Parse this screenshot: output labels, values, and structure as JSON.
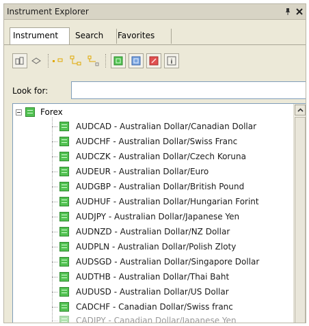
{
  "window": {
    "title": "Instrument Explorer"
  },
  "tabs": [
    {
      "label": "Instrument"
    },
    {
      "label": "Search"
    },
    {
      "label": "Favorites"
    }
  ],
  "toolbar": {
    "icons": [
      "grid-view-icon",
      "list-view-icon",
      "expand-tree-icon",
      "collapse-tree-icon",
      "group-tree-icon",
      "add-instrument-icon",
      "edit-instrument-icon",
      "delete-instrument-icon",
      "info-icon"
    ]
  },
  "lookfor": {
    "label": "Look for:",
    "value": ""
  },
  "tree": {
    "root": {
      "label": "Forex"
    },
    "items": [
      {
        "label": "AUDCAD - Australian Dollar/Canadian Dollar"
      },
      {
        "label": "AUDCHF - Australian Dollar/Swiss Franc"
      },
      {
        "label": "AUDCZK - Australian Dollar/Czech Koruna"
      },
      {
        "label": "AUDEUR - Australian Dollar/Euro"
      },
      {
        "label": "AUDGBP - Australian Dollar/British Pound"
      },
      {
        "label": "AUDHUF - Australian Dollar/Hungarian Forint"
      },
      {
        "label": "AUDJPY - Australian Dollar/Japanese Yen"
      },
      {
        "label": "AUDNZD - Australian Dollar/NZ Dollar"
      },
      {
        "label": "AUDPLN - Australian Dollar/Polish Zloty"
      },
      {
        "label": "AUDSGD - Australian Dollar/Singapore Dollar"
      },
      {
        "label": "AUDTHB - Australian Dollar/Thai Baht"
      },
      {
        "label": "AUDUSD - Australian Dollar/US Dollar"
      },
      {
        "label": "CADCHF - Canadian Dollar/Swiss franc"
      },
      {
        "label": "CADJPY - Canadian Dollar/Japanese Yen"
      }
    ]
  },
  "colors": {
    "panel": "#ece9d8",
    "instrument_icon": "#52c152",
    "border": "#7f9db9"
  }
}
